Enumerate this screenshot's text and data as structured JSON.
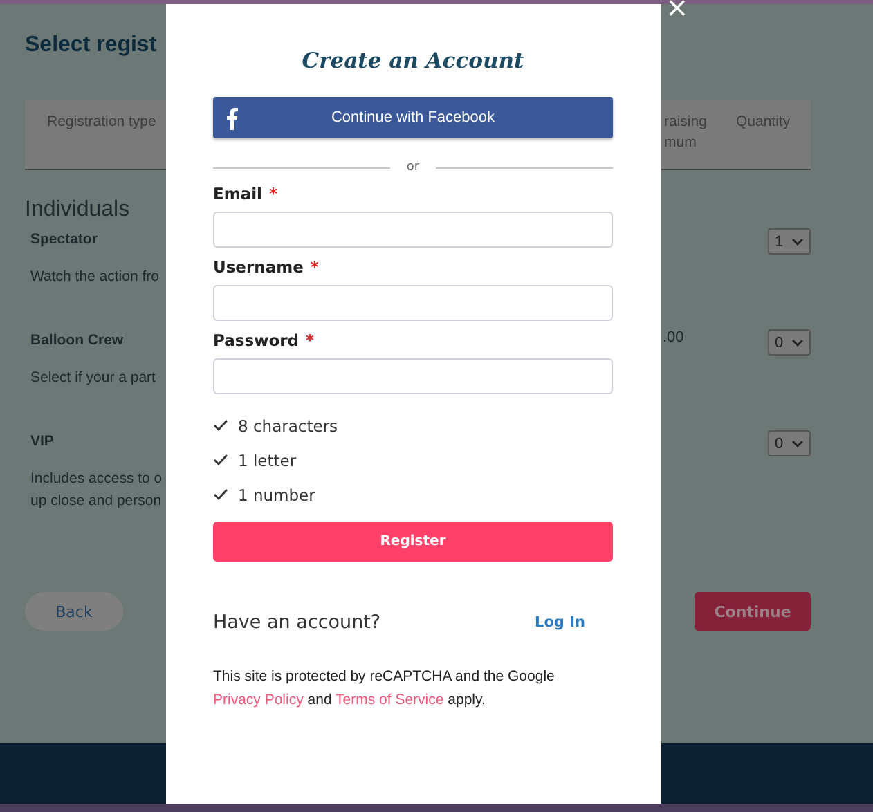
{
  "page": {
    "title": "Select regist",
    "table": {
      "columns": [
        {
          "label": "Registration type"
        },
        {
          "label": "raising\nmum"
        },
        {
          "label": "Quantity"
        }
      ]
    },
    "section": "Individuals",
    "rows": [
      {
        "name": "Spectator",
        "description": "Watch the action fro",
        "quantity": "1"
      },
      {
        "name": "Balloon Crew",
        "description": "Select if your a part",
        "price": ".00",
        "quantity": "0"
      },
      {
        "name": "VIP",
        "description": "Includes access to o\nup close and person",
        "quantity": "0"
      }
    ],
    "back_button": "Back",
    "continue_button": "Continue"
  },
  "modal": {
    "close": "×",
    "title": "Create an Account",
    "facebook_button": "Continue with Facebook",
    "divider": "or",
    "fields": [
      {
        "label": "Email",
        "required": true
      },
      {
        "label": "Username",
        "required": true
      },
      {
        "label": "Password",
        "required": true
      }
    ],
    "required_mark": "*",
    "rules": [
      {
        "text": "8 characters",
        "met": true
      },
      {
        "text": "1 letter",
        "met": true
      },
      {
        "text": "1 number",
        "met": true
      }
    ],
    "register_button": "Register",
    "have_account": "Have an account?",
    "login_link": "Log In",
    "notice": {
      "text": "This site is protected by reCAPTCHA and the Google",
      "privacy_link": "Privacy Policy",
      "and": "and",
      "terms_link": "Terms of Service",
      "tail": "apply."
    }
  }
}
